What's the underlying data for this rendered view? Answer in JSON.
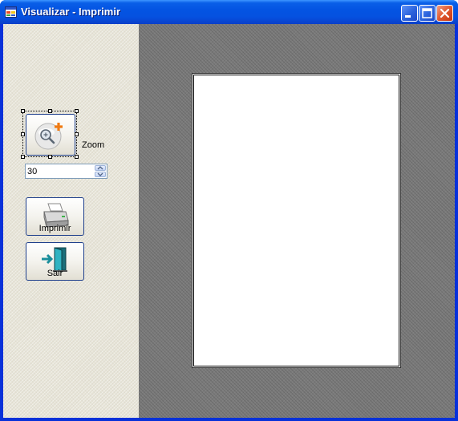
{
  "window": {
    "title": "Visualizar - Imprimir",
    "icon": "application-form-icon",
    "controls": [
      "minimize-icon",
      "maximize-icon",
      "close-icon"
    ]
  },
  "sidebar": {
    "zoom_button_icon": "zoom-in-icon",
    "zoom_label": "Zoom",
    "zoom_value": "30",
    "print_button": {
      "label": "Imprimir",
      "icon": "printer-icon"
    },
    "exit_button": {
      "label": "Sair",
      "icon": "exit-door-icon"
    }
  },
  "preview": {
    "page": "blank-page"
  },
  "colors": {
    "titlebar": "#0454e2",
    "preview_background": "#7a7a7a",
    "sidebar_background": "#e6e3d6",
    "page": "#ffffff"
  }
}
